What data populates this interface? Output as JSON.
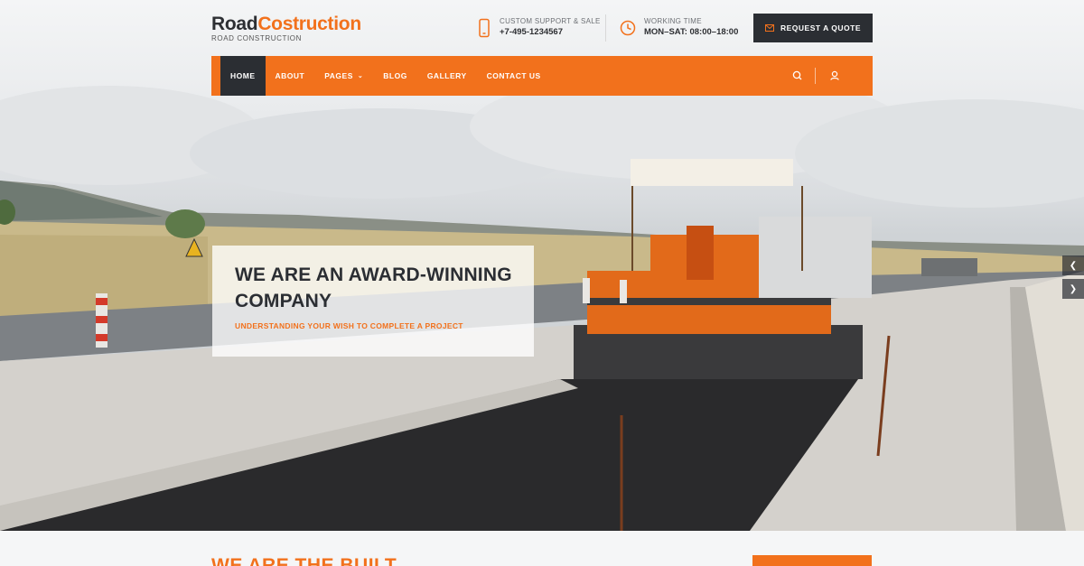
{
  "brand": {
    "name_part1": "Road",
    "name_part2": "Costruction",
    "tagline": "ROAD CONSTRUCTION"
  },
  "header": {
    "support": {
      "label": "CUSTOM SUPPORT & SALE",
      "value": "+7-495-1234567",
      "icon": "phone-icon"
    },
    "hours": {
      "label": "WORKING TIME",
      "value": "MON–SAT: 08:00–18:00",
      "icon": "clock-icon"
    },
    "quote_button": {
      "label": "REQUEST A QUOTE",
      "icon": "envelope-icon"
    }
  },
  "nav": {
    "items": [
      {
        "label": "HOME",
        "active": true
      },
      {
        "label": "ABOUT"
      },
      {
        "label": "PAGES",
        "has_dropdown": true
      },
      {
        "label": "BLOG"
      },
      {
        "label": "GALLERY"
      },
      {
        "label": "CONTACT US"
      }
    ],
    "search_icon": "search-icon",
    "user_icon": "user-icon"
  },
  "hero": {
    "title": "WE ARE AN AWARD-WINNING COMPANY",
    "subtitle": "UNDERSTANDING YOUR WISH TO COMPLETE A PROJECT",
    "prev_icon": "chevron-left-icon",
    "next_icon": "chevron-right-icon"
  },
  "section": {
    "title": "WE ARE THE BUILT"
  },
  "colors": {
    "accent": "#f2711c",
    "dark": "#2b2e33",
    "caption_bg": "#ffffff"
  }
}
